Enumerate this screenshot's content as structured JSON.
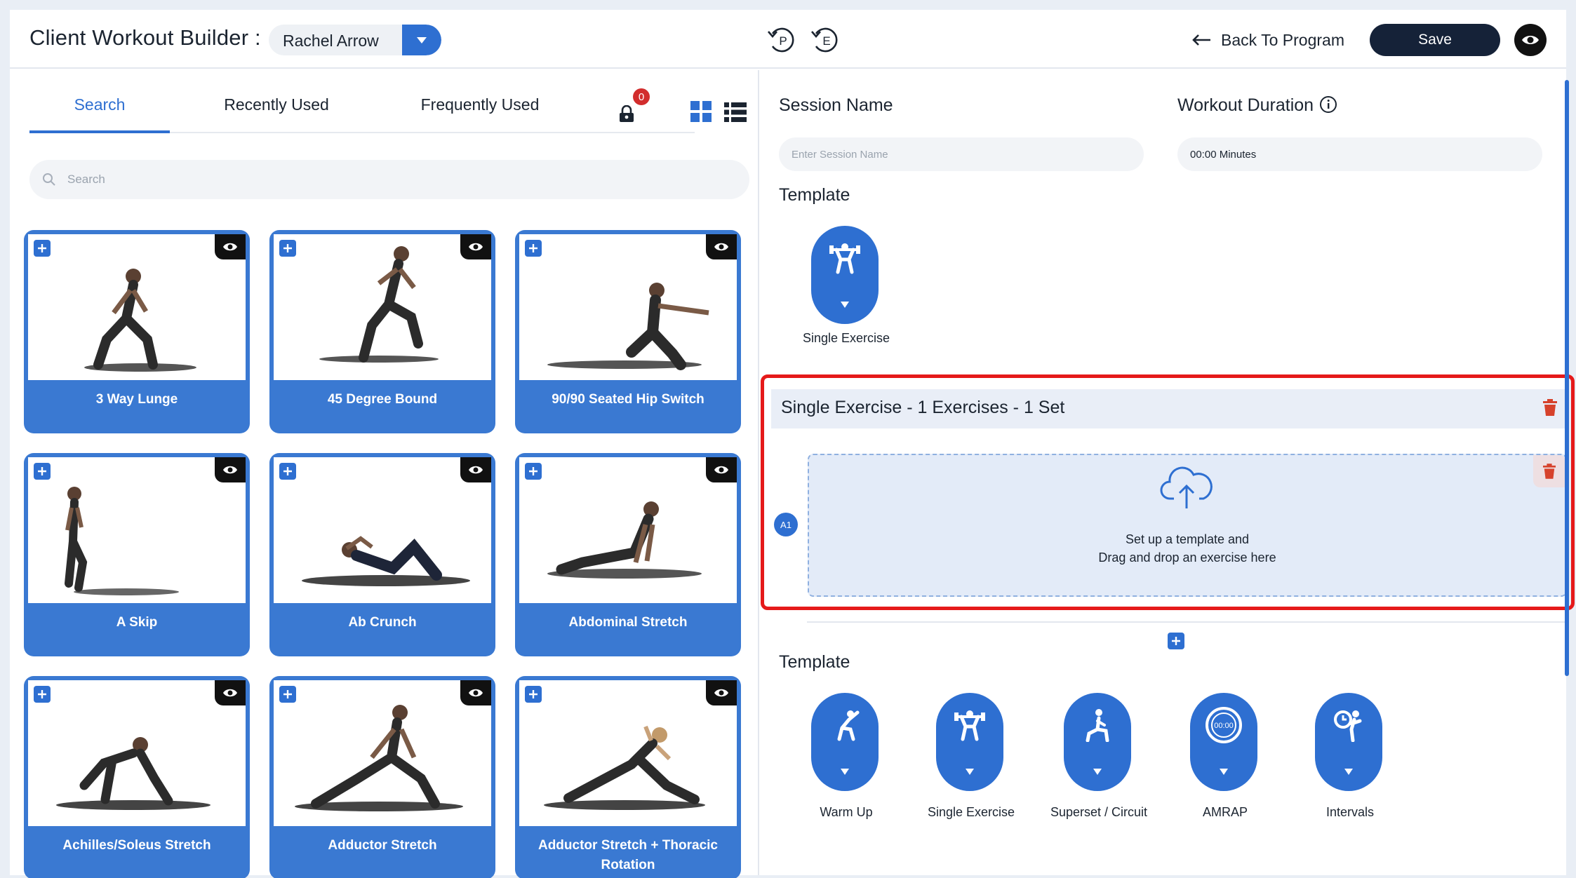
{
  "header": {
    "title": "Client Workout Builder :",
    "client_name": "Rachel Arrow",
    "history_p": "P",
    "history_e": "E",
    "back_label": "Back To Program",
    "save_label": "Save"
  },
  "tabs": [
    "Search",
    "Recently Used",
    "Frequently Used"
  ],
  "active_tab": "Search",
  "lock_badge_count": "0",
  "search": {
    "placeholder": "Search",
    "value": ""
  },
  "exercises": [
    "3 Way Lunge",
    "45 Degree Bound",
    "90/90 Seated Hip Switch",
    "A Skip",
    "Ab Crunch",
    "Abdominal Stretch",
    "Achilles/Soleus Stretch",
    "Adductor Stretch",
    "Adductor Stretch + Thoracic Rotation"
  ],
  "session": {
    "name_label": "Session Name",
    "name_placeholder": "Enter Session Name",
    "duration_label": "Workout Duration",
    "duration_value": "00:00 Minutes"
  },
  "template_selected": {
    "label": "Template",
    "option": "Single Exercise"
  },
  "block": {
    "title": "Single Exercise - 1 Exercises - 1 Set",
    "slot_label": "A1",
    "drop_line1": "Set up a template and",
    "drop_line2": "Drag and drop an exercise here"
  },
  "template_options": {
    "label": "Template",
    "items": [
      {
        "label": "Warm Up",
        "icon": "stretch-icon"
      },
      {
        "label": "Single Exercise",
        "icon": "weightlifter-icon"
      },
      {
        "label": "Superset / Circuit",
        "icon": "lunge-icon"
      },
      {
        "label": "AMRAP",
        "icon": "timer-icon",
        "timer_text": "00:00"
      },
      {
        "label": "Intervals",
        "icon": "interval-clock-icon"
      }
    ]
  },
  "colors": {
    "accent": "#2e6fd1",
    "card": "#3a79d2",
    "highlight": "#e51a1a",
    "dark": "#152238"
  }
}
